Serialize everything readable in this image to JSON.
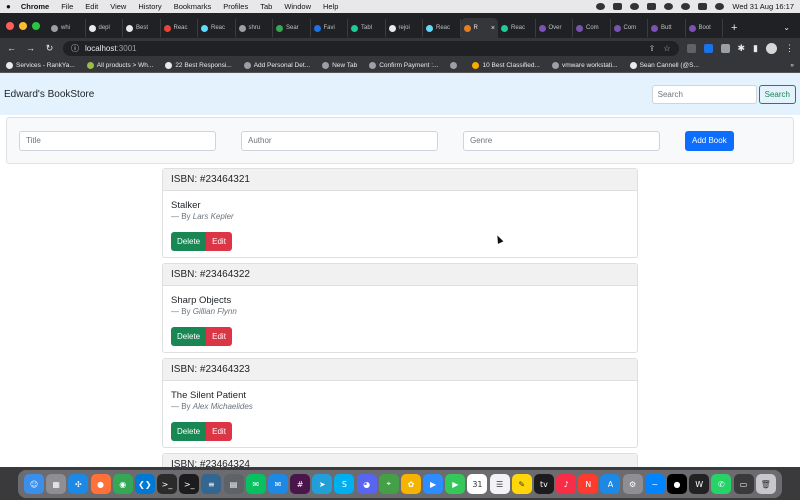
{
  "menubar": {
    "app_name": "Chrome",
    "items": [
      "File",
      "Edit",
      "View",
      "History",
      "Bookmarks",
      "Profiles",
      "Tab",
      "Window",
      "Help"
    ],
    "clock": "Wed 31 Aug  16:17"
  },
  "tabs": [
    {
      "label": "whi",
      "color": "#9aa0a6"
    },
    {
      "label": "depl",
      "color": "#e8eaed"
    },
    {
      "label": "Best",
      "color": "#e8eaed"
    },
    {
      "label": "Reac",
      "color": "#ea4335"
    },
    {
      "label": "Reac",
      "color": "#61dafb"
    },
    {
      "label": "shru",
      "color": "#9aa0a6"
    },
    {
      "label": "Sear",
      "color": "#34a853"
    },
    {
      "label": "Favi",
      "color": "#1a73e8"
    },
    {
      "label": "Tabl",
      "color": "#20c997"
    },
    {
      "label": "rejoi",
      "color": "#e8eaed"
    },
    {
      "label": "Reac",
      "color": "#61dafb"
    },
    {
      "label": "R",
      "color": "#e67e22",
      "active": true
    },
    {
      "label": "Reac",
      "color": "#20c997"
    },
    {
      "label": "Over",
      "color": "#7952b3"
    },
    {
      "label": "Com",
      "color": "#7952b3"
    },
    {
      "label": "Com",
      "color": "#7952b3"
    },
    {
      "label": "Butt",
      "color": "#7952b3"
    },
    {
      "label": "Boot",
      "color": "#7952b3"
    }
  ],
  "address": {
    "host": "localhost",
    "port": ":3001"
  },
  "bookmarks": [
    {
      "label": "Services - RankYa...",
      "color": "#e8eaed"
    },
    {
      "label": "All products > Wh...",
      "color": "#95bf47"
    },
    {
      "label": "22 Best Responsi...",
      "color": "#e8eaed"
    },
    {
      "label": "Add Personal Det...",
      "color": "#9aa0a6"
    },
    {
      "label": "New Tab",
      "color": "#9aa0a6"
    },
    {
      "label": "Confirm Payment :...",
      "color": "#9aa0a6"
    },
    {
      "label": "",
      "color": "#9aa0a6"
    },
    {
      "label": "10 Best Classified...",
      "color": "#f9ab00"
    },
    {
      "label": "vmware workstati...",
      "color": "#9aa0a6"
    },
    {
      "label": "Sean Cannell (@S...",
      "color": "#e8eaed"
    }
  ],
  "navbar": {
    "brand": "Edward's BookStore",
    "search_placeholder": "Search",
    "search_button": "Search"
  },
  "add_form": {
    "title_placeholder": "Title",
    "author_placeholder": "Author",
    "genre_placeholder": "Genre",
    "submit_label": "Add Book"
  },
  "books": [
    {
      "isbn": "ISBN: #23464321",
      "title": "Stalker",
      "by": "— By ",
      "author": "Lars Kepler",
      "delete": "Delete",
      "edit": "Edit"
    },
    {
      "isbn": "ISBN: #23464322",
      "title": "Sharp Objects",
      "by": "— By ",
      "author": "Gillian Flynn",
      "delete": "Delete",
      "edit": "Edit"
    },
    {
      "isbn": "ISBN: #23464323",
      "title": "The Silent Patient",
      "by": "— By ",
      "author": "Alex Michaelides",
      "delete": "Delete",
      "edit": "Edit"
    },
    {
      "isbn": "ISBN: #23464324",
      "title": "",
      "by": "",
      "author": "",
      "delete": "",
      "edit": ""
    }
  ],
  "dock": [
    {
      "name": "finder",
      "color": "#3b8eea",
      "glyph": "☺"
    },
    {
      "name": "launchpad",
      "color": "#8e8e93",
      "glyph": "▦"
    },
    {
      "name": "safari",
      "color": "#1e88e5",
      "glyph": "✣"
    },
    {
      "name": "firefox",
      "color": "#ff7139",
      "glyph": "●"
    },
    {
      "name": "chrome",
      "color": "#34a853",
      "glyph": "◉"
    },
    {
      "name": "vscode",
      "color": "#0078d4",
      "glyph": "❮❯"
    },
    {
      "name": "terminal",
      "color": "#2b2b2b",
      "glyph": ">_"
    },
    {
      "name": "terminal-2",
      "color": "#1c1c1e",
      "glyph": ">_"
    },
    {
      "name": "database",
      "color": "#336791",
      "glyph": "≡"
    },
    {
      "name": "files",
      "color": "#5f6368",
      "glyph": "▤"
    },
    {
      "name": "wechat",
      "color": "#07c160",
      "glyph": "✉"
    },
    {
      "name": "mail",
      "color": "#1e88e5",
      "glyph": "✉"
    },
    {
      "name": "slack",
      "color": "#4a154b",
      "glyph": "#"
    },
    {
      "name": "telegram",
      "color": "#229ed9",
      "glyph": "➤"
    },
    {
      "name": "skype",
      "color": "#00aff0",
      "glyph": "S"
    },
    {
      "name": "discord",
      "color": "#5865f2",
      "glyph": "◕"
    },
    {
      "name": "maps",
      "color": "#43a047",
      "glyph": "⌖"
    },
    {
      "name": "photos",
      "color": "#f4b400",
      "glyph": "✿"
    },
    {
      "name": "zoom",
      "color": "#2d8cff",
      "glyph": "▶"
    },
    {
      "name": "facetime",
      "color": "#34c759",
      "glyph": "▶"
    },
    {
      "name": "calendar",
      "color": "#ffffff",
      "glyph": "31"
    },
    {
      "name": "reminders",
      "color": "#f2f2f7",
      "glyph": "☰"
    },
    {
      "name": "notes",
      "color": "#ffd60a",
      "glyph": "✎"
    },
    {
      "name": "tv",
      "color": "#1c1c1e",
      "glyph": "tv"
    },
    {
      "name": "music",
      "color": "#fa2d48",
      "glyph": "♪"
    },
    {
      "name": "news",
      "color": "#ff3b30",
      "glyph": "N"
    },
    {
      "name": "app-store",
      "color": "#1e88e5",
      "glyph": "A"
    },
    {
      "name": "system-settings",
      "color": "#8e8e93",
      "glyph": "⚙"
    },
    {
      "name": "messenger",
      "color": "#0084ff",
      "glyph": "~"
    },
    {
      "name": "app-black",
      "color": "#000000",
      "glyph": "●"
    },
    {
      "name": "writer",
      "color": "#222222",
      "glyph": "W"
    },
    {
      "name": "whatsapp",
      "color": "#25d366",
      "glyph": "✆"
    },
    {
      "name": "screenshot",
      "color": "#3a3a3c",
      "glyph": "▭"
    },
    {
      "name": "trash",
      "color": "#c7c7cc",
      "glyph": "🗑"
    }
  ]
}
